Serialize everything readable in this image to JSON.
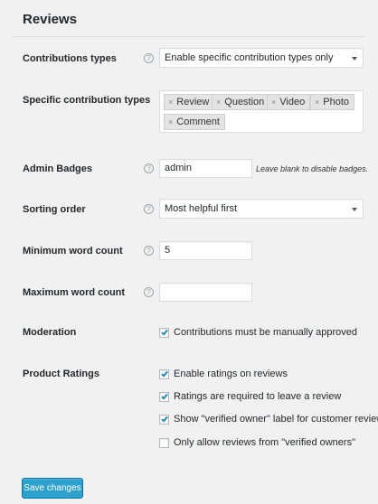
{
  "section": {
    "title": "Reviews"
  },
  "contribution_types": {
    "label": "Contributions types",
    "selected": "Enable specific contribution types only"
  },
  "specific_types": {
    "label": "Specific contribution types",
    "tags": [
      "Review",
      "Question",
      "Video",
      "Photo",
      "Comment"
    ]
  },
  "admin_badges": {
    "label": "Admin Badges",
    "value": "admin",
    "description": "Leave blank to disable badges."
  },
  "sorting_order": {
    "label": "Sorting order",
    "selected": "Most helpful first"
  },
  "min_word_count": {
    "label": "Minimum word count",
    "value": "5"
  },
  "max_word_count": {
    "label": "Maximum word count",
    "value": ""
  },
  "moderation": {
    "label": "Moderation",
    "options": [
      {
        "label": "Contributions must be manually approved",
        "checked": true
      }
    ]
  },
  "product_ratings": {
    "label": "Product Ratings",
    "options": [
      {
        "label": "Enable ratings on reviews",
        "checked": true
      },
      {
        "label": "Ratings are required to leave a review",
        "checked": true
      },
      {
        "label": "Show \"verified owner\" label for customer reviews",
        "checked": true
      },
      {
        "label": "Only allow reviews from \"verified owners\"",
        "checked": false
      }
    ]
  },
  "help_glyph": "?",
  "tag_remove_glyph": "×",
  "save_button": {
    "label": "Save changes"
  },
  "colors": {
    "accent": "#2ea2cc",
    "background": "#f1f1f1",
    "check": "#1e8cbe"
  },
  "icons": {
    "help": "help-icon",
    "dropdown": "chevron-down-icon",
    "tag_remove": "close-icon",
    "checkmark": "checkmark-icon"
  }
}
